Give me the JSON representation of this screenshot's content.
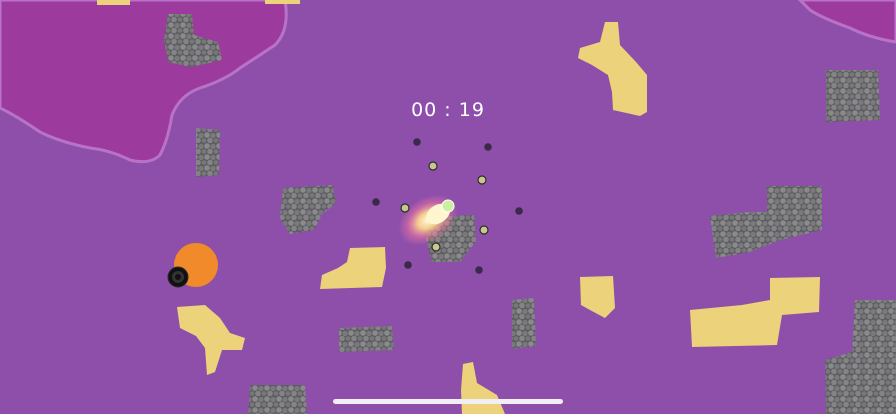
{
  "hud": {
    "timer": "00 : 19"
  },
  "colors": {
    "ground": "#8e4fab",
    "deep_zone": "#9c3a9e",
    "sand": "#ecd27a",
    "rock": "#7d7d7d",
    "player_orange": "#f08a2a",
    "burst": "#fff3b0"
  },
  "icons": {
    "player": "orange-circle-with-black-cannon",
    "projectile": "glowing-comet"
  }
}
